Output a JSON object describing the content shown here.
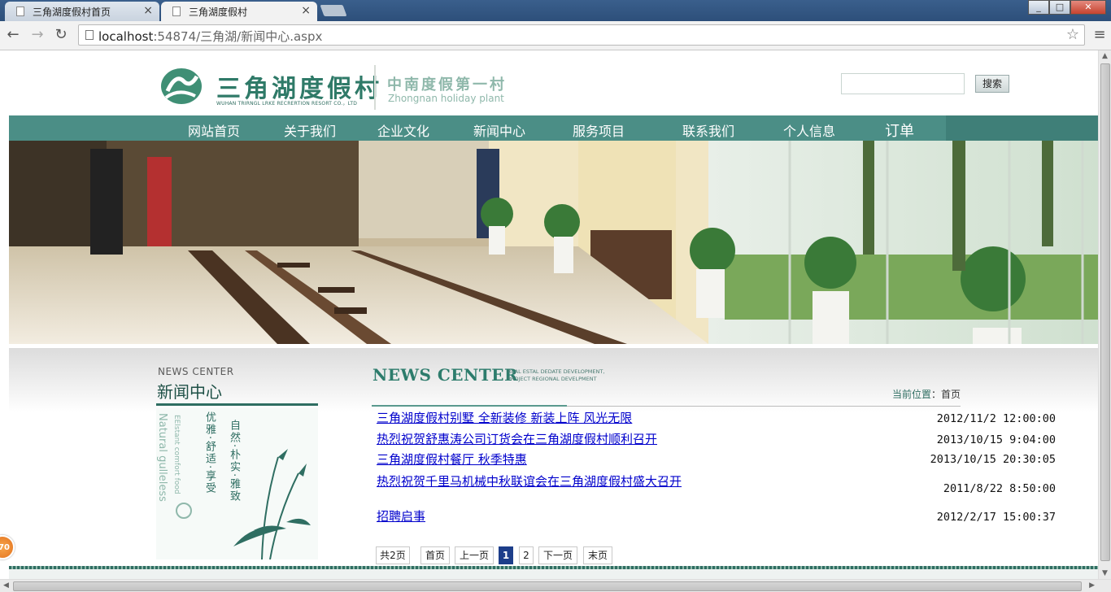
{
  "browser": {
    "tabs": [
      {
        "title": "三角湖度假村首页",
        "active": false
      },
      {
        "title": "三角湖度假村",
        "active": true
      }
    ],
    "tab_close": "×",
    "url_host": "localhost",
    "url_rest": ":54874/三角湖/新闻中心.aspx",
    "icons": {
      "back": "←",
      "forward": "→",
      "reload": "↻",
      "star": "☆",
      "menu": "≡",
      "minimize": "_",
      "maximize": "□",
      "close": "✕"
    }
  },
  "header": {
    "logo_title": "三角湖度假村",
    "logo_subtitle": "WUHAN TRIRNGL LRKE RECRERTION RESORT CO.，LTD",
    "slogan_cn": "中南度假第一村",
    "slogan_en": "Zhongnan holiday plant",
    "search_placeholder": "",
    "search_button": "搜索"
  },
  "nav": {
    "items": [
      "网站首页",
      "关于我们",
      "企业文化",
      "新闻中心",
      "服务项目",
      "联系我们",
      "个人信息",
      "订单"
    ]
  },
  "sidebar": {
    "title_en": "NEWS CENTER",
    "title_cn": "新闻中心",
    "art_text_col1": "自然·朴实·雅致",
    "art_text_col2": "优雅·舒适·享受",
    "art_text_en1": "EElstant comfort food",
    "art_text_en2": "Natural gulleless"
  },
  "content": {
    "heading": "NEWS CENTER",
    "heading_sub1": "REAL ESTAL DEDATE DEVELOPMENT,",
    "heading_sub2": "PROJECT REGIONAL DEVELPMENT",
    "breadcrumb_label": "当前位置",
    "breadcrumb_sep": "：",
    "breadcrumb_value": "首页",
    "news": [
      {
        "title": "三角湖度假村别墅 全新装修 新装上阵 风光无限",
        "date": "2012/11/2 12:00:00"
      },
      {
        "title": "热烈祝贺舒惠涛公司订货会在三角湖度假村顺利召开",
        "date": "2013/10/15 9:04:00"
      },
      {
        "title": "三角湖度假村餐厅 秋季特惠",
        "date": "2013/10/15 20:30:05"
      },
      {
        "title": "热烈祝贺千里马机械中秋联谊会在三角湖度假村盛大召开",
        "date": "2011/8/22 8:50:00"
      },
      {
        "title": "招聘启事",
        "date": "2012/2/17 15:00:37"
      }
    ],
    "pager": {
      "total": "共2页",
      "first": "首页",
      "prev": "上一页",
      "pages": [
        "1",
        "2"
      ],
      "current": "1",
      "next": "下一页",
      "last": "末页"
    }
  },
  "float_badge": "70",
  "colors": {
    "brand_green": "#4b8e86",
    "link_blue": "#0000cc",
    "pager_active": "#1d3e8a"
  }
}
